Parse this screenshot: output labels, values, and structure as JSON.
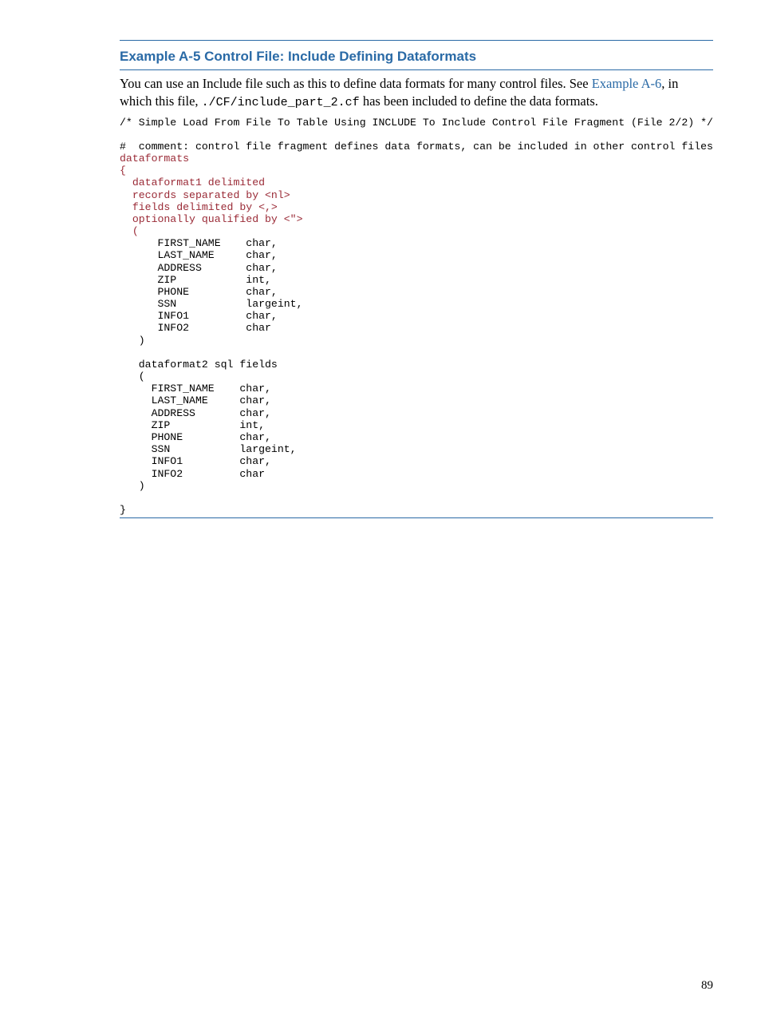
{
  "heading": "Example A-5 Control File: Include Defining Dataformats",
  "intro_part1": "You can use an Include file such as this to define data formats for many control files. See ",
  "example_link": "Example A-6",
  "intro_part2": ", in which this file, ",
  "inline_code": "./CF/include_part_2.cf",
  "intro_part3": " has been included to define the data formats.",
  "c1": "/* Simple Load From File To Table Using INCLUDE To Include Control File Fragment (File 2/2) */",
  "c2": "#  comment: control file fragment defines data formats, can be included in other control files",
  "c3": "dataformats",
  "c4": "{",
  "c5": "  dataformat1 delimited",
  "c6": "  records separated by <nl>",
  "c7": "  fields delimited by <,>",
  "c8": "  optionally qualified by <\">",
  "c9": "  (",
  "c10": "      FIRST_NAME    char,",
  "c11": "      LAST_NAME     char,",
  "c12": "      ADDRESS       char,",
  "c13": "      ZIP           int,",
  "c14": "      PHONE         char,",
  "c15": "      SSN           largeint,",
  "c16": "      INFO1         char,",
  "c17": "      INFO2         char",
  "c18": "   )",
  "c19": "",
  "c20": "   dataformat2 sql fields",
  "c21": "   (",
  "c22": "     FIRST_NAME    char,",
  "c23": "     LAST_NAME     char,",
  "c24": "     ADDRESS       char,",
  "c25": "     ZIP           int,",
  "c26": "     PHONE         char,",
  "c27": "     SSN           largeint,",
  "c28": "     INFO1         char,",
  "c29": "     INFO2         char",
  "c30": "   )",
  "c31": "",
  "c32": "}",
  "page_number": "89"
}
